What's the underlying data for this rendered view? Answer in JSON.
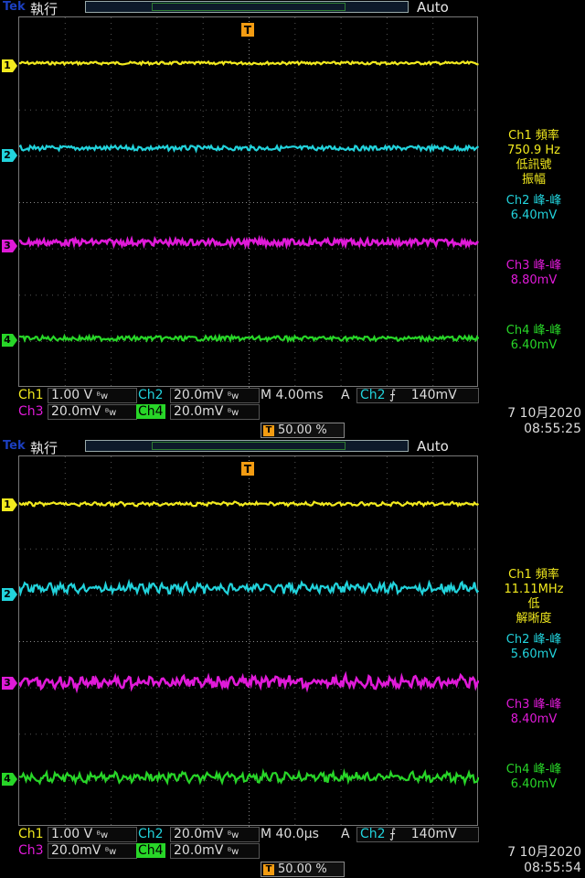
{
  "colors": {
    "ch1": "#f2ea1e",
    "ch2": "#22d3dc",
    "ch3": "#e01ad8",
    "ch4": "#28d628",
    "trigger": "#f39c12",
    "brand": "#1b3fbf"
  },
  "panels": [
    {
      "brand": "Tek",
      "run_state": "執行",
      "trigger_mode": "Auto",
      "trigger_marker": "T",
      "channel_markers": [
        "1",
        "2",
        "3",
        "4"
      ],
      "measurements": {
        "ch1_label": "Ch1 頻率",
        "ch1_value": "750.9 Hz",
        "ch1_note1": "低訊號",
        "ch1_note2": "振幅",
        "ch2_label": "Ch2 峰-峰",
        "ch2_value": "6.40mV",
        "ch3_label": "Ch3 峰-峰",
        "ch3_value": "8.80mV",
        "ch4_label": "Ch4 峰-峰",
        "ch4_value": "6.40mV"
      },
      "status": {
        "ch1": "Ch1",
        "ch1_scale": "1.00 V",
        "ch2": "Ch2",
        "ch2_scale": "20.0mV",
        "timebase": "M 4.00ms",
        "acq": "A",
        "trig_src": "Ch2",
        "trig_slope": "⨍",
        "trig_level": "140mV",
        "ch3": "Ch3",
        "ch3_scale": "20.0mV",
        "ch4": "Ch4",
        "ch4_scale": "20.0mV",
        "bw": "ᴮw",
        "trig_position": "50.00 %",
        "date": "7 10月2020",
        "time": "08:55:25"
      }
    },
    {
      "brand": "Tek",
      "run_state": "執行",
      "trigger_mode": "Auto",
      "trigger_marker": "T",
      "channel_markers": [
        "1",
        "2",
        "3",
        "4"
      ],
      "measurements": {
        "ch1_label": "Ch1 頻率",
        "ch1_value": "11.11MHz",
        "ch1_note1": "低",
        "ch1_note2": "解晰度",
        "ch2_label": "Ch2 峰-峰",
        "ch2_value": "5.60mV",
        "ch3_label": "Ch3 峰-峰",
        "ch3_value": "8.40mV",
        "ch4_label": "Ch4 峰-峰",
        "ch4_value": "6.40mV"
      },
      "status": {
        "ch1": "Ch1",
        "ch1_scale": "1.00 V",
        "ch2": "Ch2",
        "ch2_scale": "20.0mV",
        "timebase": "M 40.0µs",
        "acq": "A",
        "trig_src": "Ch2",
        "trig_slope": "⨍",
        "trig_level": "140mV",
        "ch3": "Ch3",
        "ch3_scale": "20.0mV",
        "ch4": "Ch4",
        "ch4_scale": "20.0mV",
        "bw": "ᴮw",
        "trig_position": "50.00 %",
        "date": "7 10月2020",
        "time": "08:55:54"
      }
    }
  ]
}
